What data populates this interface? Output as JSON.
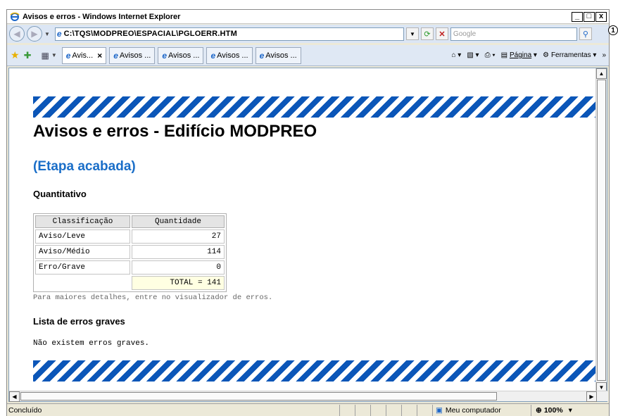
{
  "window": {
    "title": "Avisos e erros - Windows Internet Explorer",
    "minimize_label": "_",
    "maximize_label": "□",
    "close_label": "x"
  },
  "address": {
    "url": "C:\\TQS\\MODPREO\\ESPACIAL\\PGLOERR.HTM",
    "search_placeholder": "Google"
  },
  "tabs": [
    {
      "label": "Avis..."
    },
    {
      "label": "Avisos ..."
    },
    {
      "label": "Avisos ..."
    },
    {
      "label": "Avisos ..."
    },
    {
      "label": "Avisos ..."
    }
  ],
  "commands": {
    "page": "Página",
    "tools": "Ferramentas"
  },
  "page": {
    "heading": "Avisos e erros - Edifício MODPREO",
    "stage": "(Etapa acabada)",
    "quant_heading": "Quantitativo",
    "table_headers": [
      "Classificação",
      "Quantidade"
    ],
    "rows": [
      {
        "label": "Aviso/Leve",
        "value": "27"
      },
      {
        "label": "Aviso/Médio",
        "value": "114"
      },
      {
        "label": "Erro/Grave",
        "value": "0"
      }
    ],
    "total": "TOTAL = 141",
    "note": "Para maiores detalhes, entre no visualizador de erros.",
    "serious_heading": "Lista de erros graves",
    "serious_text": "Não existem erros graves."
  },
  "status": {
    "text": "Concluído",
    "zone": "Meu computador",
    "zoom": "100%"
  },
  "annotation": "1",
  "colors": {
    "stripe": "#0b56b8",
    "stage_heading": "#1a6ec8",
    "total_bg": "#ffffe2"
  }
}
